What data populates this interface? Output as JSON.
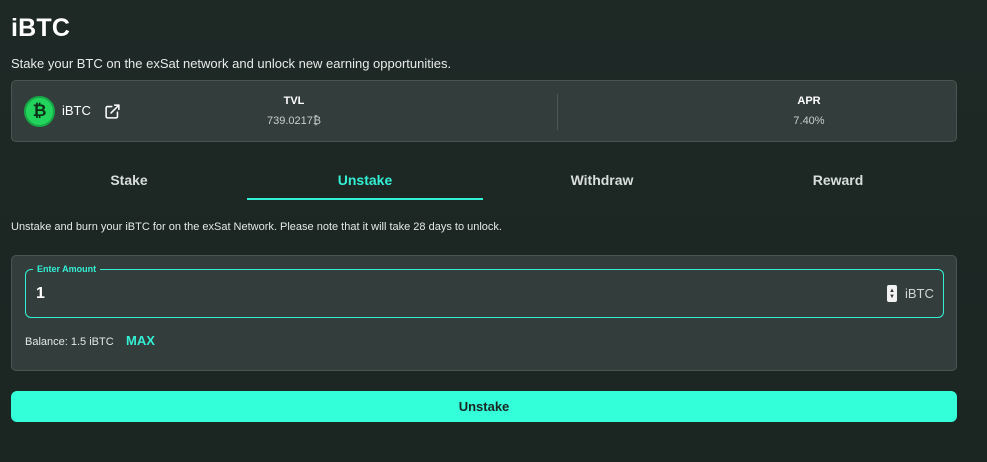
{
  "header": {
    "title": "iBTC",
    "subtitle": "Stake your BTC on the exSat network and unlock new earning opportunities."
  },
  "token": {
    "name": "iBTC",
    "icon": "bitcoin-coin-icon",
    "link_icon": "external-link-icon",
    "brand_color": "#22d35c"
  },
  "stats": {
    "tvl": {
      "label": "TVL",
      "value": "739.0217₿"
    },
    "apr": {
      "label": "APR",
      "value": "7.40%"
    }
  },
  "tabs": [
    {
      "label": "Stake",
      "active": false
    },
    {
      "label": "Unstake",
      "active": true
    },
    {
      "label": "Withdraw",
      "active": false
    },
    {
      "label": "Reward",
      "active": false
    }
  ],
  "description": "Unstake and burn your iBTC for on the exSat Network. Please note that it will take 28 days to unlock.",
  "form": {
    "amount_label": "Enter Amount",
    "amount_value": "1",
    "unit": "iBTC",
    "balance": "Balance: 1.5 iBTC",
    "max_label": "MAX"
  },
  "submit_label": "Unstake",
  "colors": {
    "accent": "#33f0d5",
    "button": "#33ffd9",
    "background": "#1e2926",
    "card": "#333d3b"
  }
}
